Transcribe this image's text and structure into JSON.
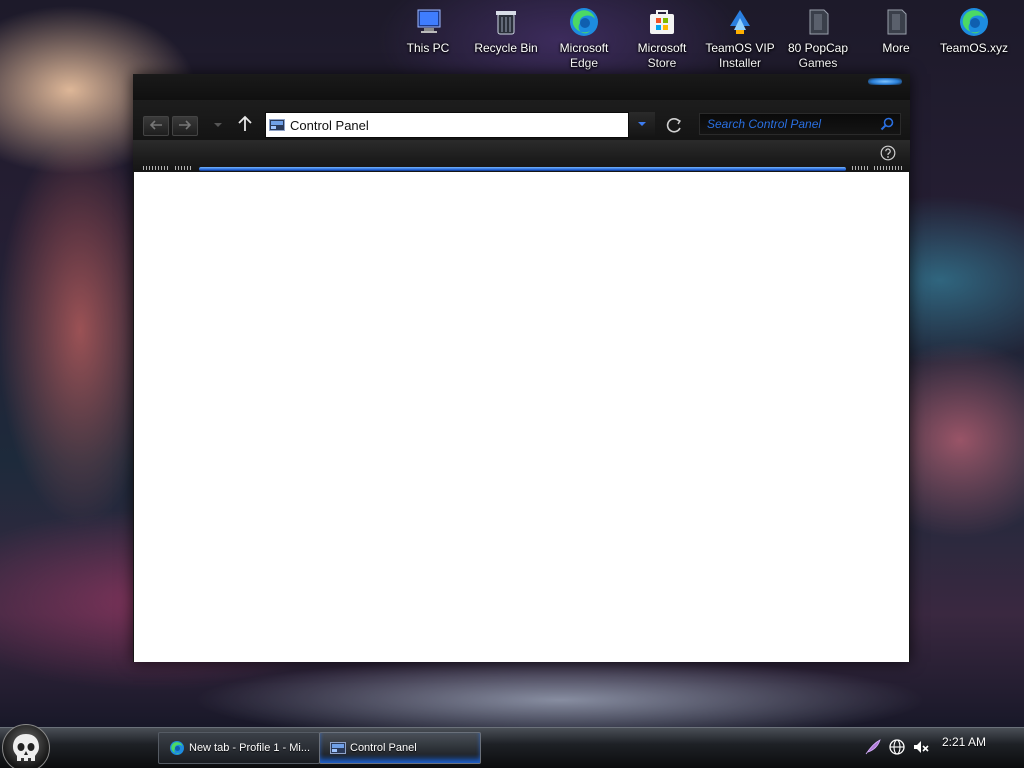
{
  "desktop": {
    "icons": [
      {
        "label": "This PC",
        "icon": "this-pc-icon"
      },
      {
        "label": "Recycle Bin",
        "icon": "recycle-bin-icon"
      },
      {
        "label": "Microsoft Edge",
        "icon": "edge-icon"
      },
      {
        "label": "Microsoft Store",
        "icon": "store-icon"
      },
      {
        "label": "TeamOS VIP Installer",
        "icon": "installer-icon"
      },
      {
        "label": "80 PopCap Games",
        "icon": "popcap-icon"
      },
      {
        "label": "More",
        "icon": "more-icon"
      },
      {
        "label": "TeamOS.xyz",
        "icon": "edge-icon"
      }
    ]
  },
  "explorer": {
    "address": "Control Panel",
    "search_placeholder": "Search Control Panel",
    "accent_color": "#2a6fe0"
  },
  "taskbar": {
    "items": [
      {
        "label": "New tab - Profile 1 - Mi...",
        "icon": "edge-icon"
      },
      {
        "label": "Control Panel",
        "icon": "control-panel-icon",
        "active": true
      }
    ],
    "clock": "2:21 AM"
  }
}
